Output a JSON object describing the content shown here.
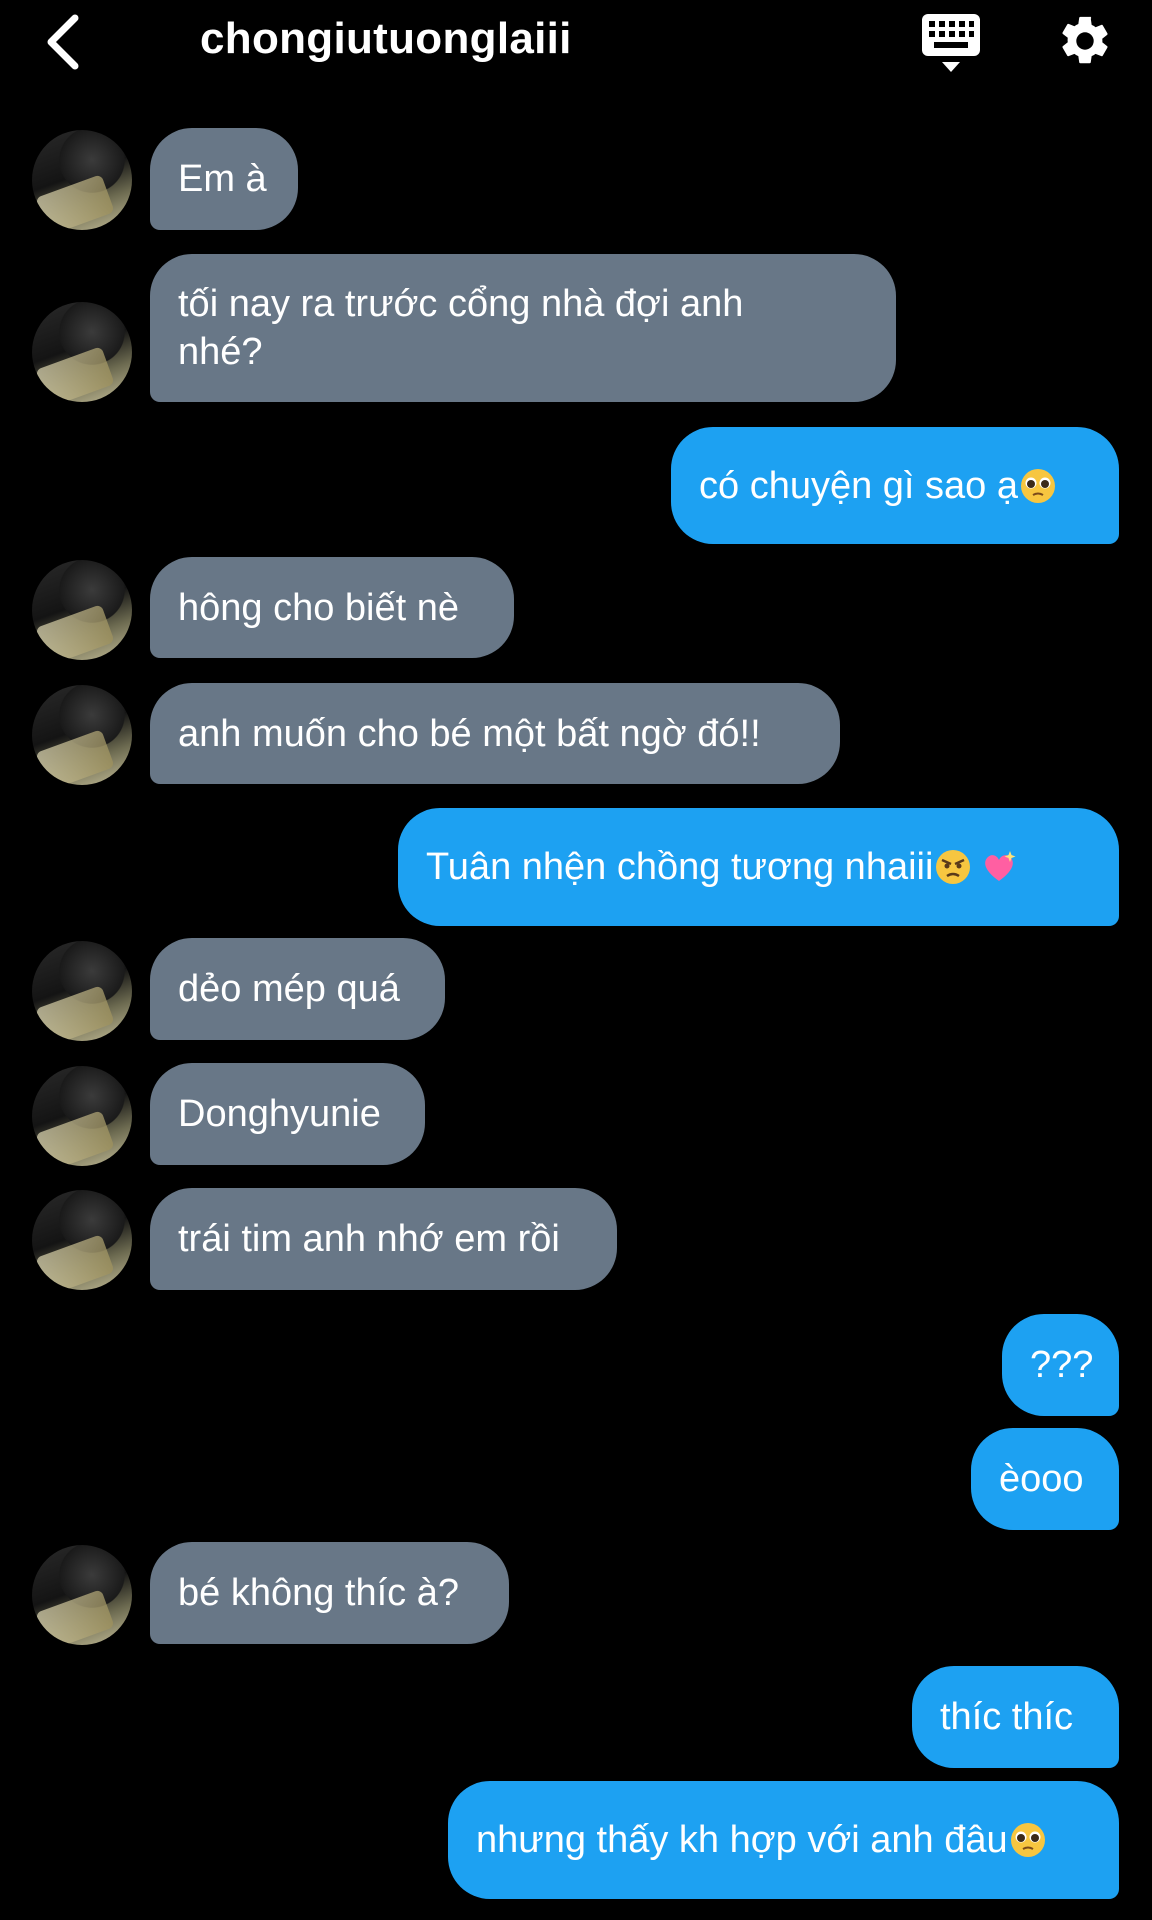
{
  "header": {
    "title": "chongiutuonglaiii",
    "back_icon": "chevron-left-icon",
    "keyboard_icon": "keyboard-icon",
    "settings_icon": "gear-icon"
  },
  "colors": {
    "incoming_bubble": "#687787",
    "outgoing_bubble": "#1da1f2",
    "background": "#000000"
  },
  "messages": [
    {
      "side": "in",
      "text": "Em à"
    },
    {
      "side": "in",
      "text": "tối nay ra trước cổng nhà đợi anh\nnhé?"
    },
    {
      "side": "out",
      "text": "có chuyện gì sao ạ",
      "emoji": "pleading-face"
    },
    {
      "side": "in",
      "text": "hông cho biết nè"
    },
    {
      "side": "in",
      "text": "anh muốn cho bé một bất ngờ đó!!"
    },
    {
      "side": "out",
      "text": "Tuân nhện chồng tương nhaiii",
      "emoji": "angry-face sparkling-heart"
    },
    {
      "side": "in",
      "text": "dẻo mép quá"
    },
    {
      "side": "in",
      "text": "Donghyunie"
    },
    {
      "side": "in",
      "text": "trái tim anh nhớ em rồi"
    },
    {
      "side": "out",
      "text": "???"
    },
    {
      "side": "out",
      "text": "èooo"
    },
    {
      "side": "in",
      "text": "bé không thíc à?"
    },
    {
      "side": "out",
      "text": "thíc thíc"
    },
    {
      "side": "out",
      "text": "nhưng thấy kh hợp với anh đâu",
      "emoji": "pleading-face"
    }
  ]
}
